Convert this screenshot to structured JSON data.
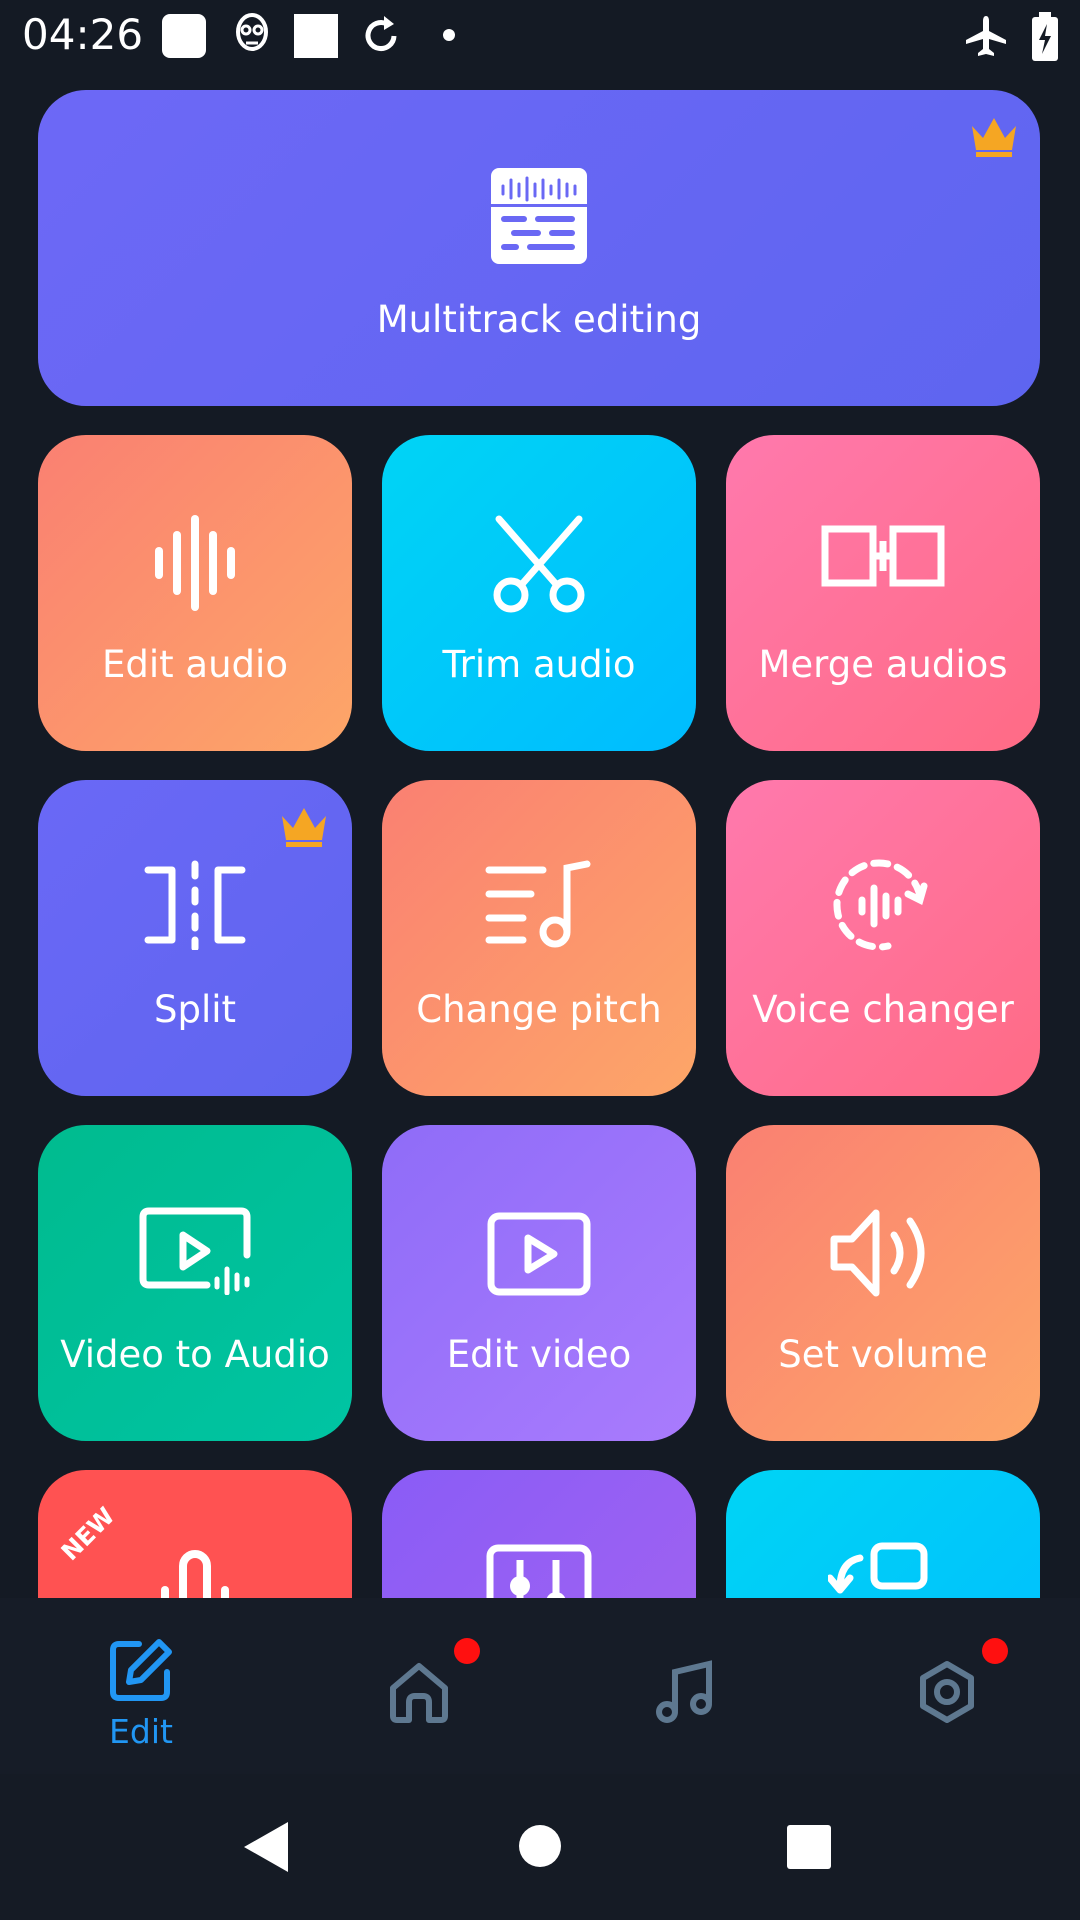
{
  "status_bar": {
    "time": "04:26",
    "icons": [
      "square-notification-icon",
      "alien-icon",
      "square-notification-icon",
      "sync-icon",
      "dot-icon",
      "airplane-mode-icon",
      "battery-charging-icon"
    ]
  },
  "tools": {
    "multitrack": {
      "label": "Multitrack editing",
      "icon": "multitrack-icon",
      "premium": true
    },
    "items": [
      {
        "label": "Edit audio",
        "icon": "waveform-icon",
        "premium": false
      },
      {
        "label": "Trim audio",
        "icon": "scissors-icon",
        "premium": false
      },
      {
        "label": "Merge audios",
        "icon": "merge-icon",
        "premium": false
      },
      {
        "label": "Split",
        "icon": "split-icon",
        "premium": true
      },
      {
        "label": "Change pitch",
        "icon": "pitch-icon",
        "premium": false
      },
      {
        "label": "Voice changer",
        "icon": "voice-changer-icon",
        "premium": false
      },
      {
        "label": "Video to Audio",
        "icon": "video-to-audio-icon",
        "premium": false
      },
      {
        "label": "Edit video",
        "icon": "play-icon",
        "premium": false
      },
      {
        "label": "Set volume",
        "icon": "volume-icon",
        "premium": false
      }
    ],
    "partial": [
      {
        "badge": "NEW",
        "icon": "microphone-icon"
      },
      {
        "icon": "equalizer-icon"
      },
      {
        "icon": "convert-icon"
      }
    ]
  },
  "colors": {
    "background": "#141a24",
    "accent": "#2196f3",
    "inactive_icon": "#5e7890",
    "crown": "#f5a623",
    "notification_dot": "#ff1010"
  },
  "bottom_nav": {
    "items": [
      {
        "label": "Edit",
        "icon": "edit-icon",
        "active": true,
        "badge": false
      },
      {
        "label": "",
        "icon": "home-icon",
        "active": false,
        "badge": true
      },
      {
        "label": "",
        "icon": "music-note-icon",
        "active": false,
        "badge": false
      },
      {
        "label": "",
        "icon": "settings-icon",
        "active": false,
        "badge": true
      }
    ]
  },
  "system_nav": [
    "back-icon",
    "home-circle-icon",
    "recents-icon"
  ]
}
